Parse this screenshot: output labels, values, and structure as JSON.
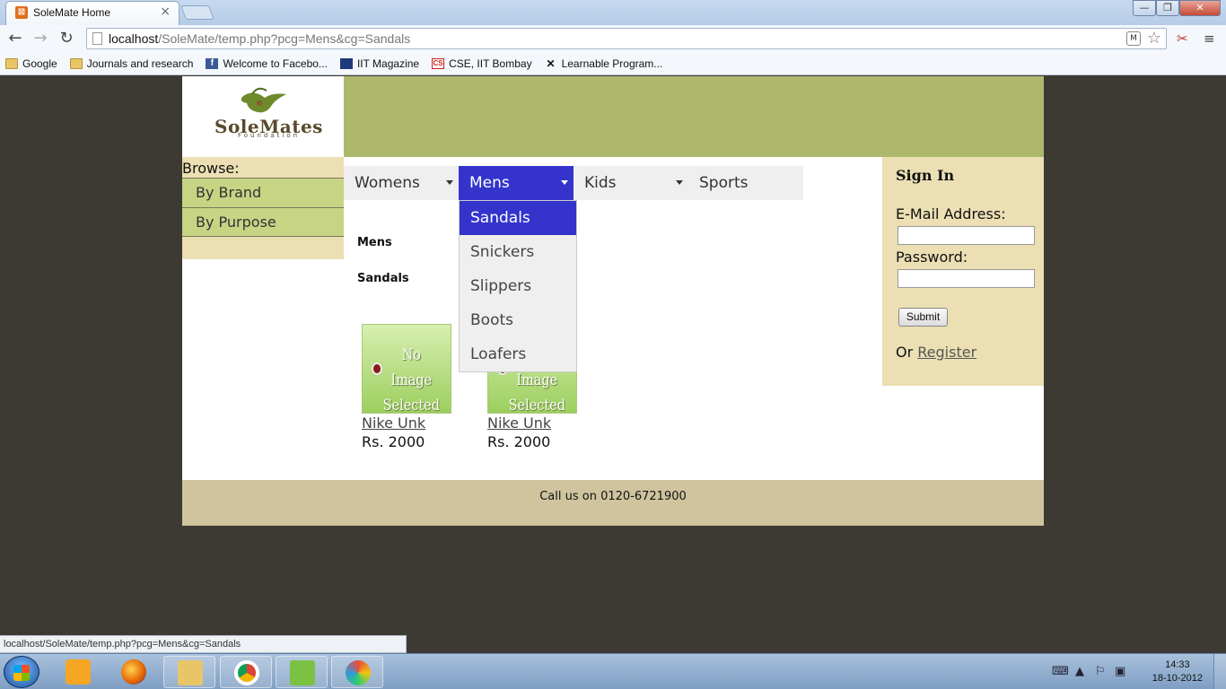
{
  "browser": {
    "tab_title": "SoleMate Home",
    "tab_close": "×",
    "window_controls": {
      "minimize": "—",
      "maximize": "❐",
      "close": "✕"
    },
    "url_host": "localhost",
    "url_path": "/SoleMate/temp.php?pcg=Mens&cg=Sandals",
    "bookmarks": [
      {
        "label": "Google",
        "icon": "folder-icon"
      },
      {
        "label": "Journals and research",
        "icon": "folder-icon"
      },
      {
        "label": "Welcome to Facebo...",
        "icon": "facebook-icon"
      },
      {
        "label": "IIT Magazine",
        "icon": "iit-icon"
      },
      {
        "label": "CSE, IIT Bombay",
        "icon": "cse-icon"
      },
      {
        "label": "Learnable Program...",
        "icon": "learnable-icon"
      }
    ],
    "status_url": "localhost/SoleMate/temp.php?pcg=Mens&cg=Sandals"
  },
  "site": {
    "logo_text": "SoleMates",
    "logo_subtext": "Foundation",
    "browse": {
      "title": "Browse:",
      "items": [
        "By Brand",
        "By Purpose"
      ]
    },
    "menu": {
      "items": [
        "Womens",
        "Mens",
        "Kids",
        "Sports"
      ],
      "active": "Mens",
      "dropdown": [
        "Sandals",
        "Snickers",
        "Slippers",
        "Boots",
        "Loafers"
      ],
      "dropdown_active": "Sandals"
    },
    "breadcrumb": {
      "category": "Mens",
      "subcategory": "Sandals"
    },
    "products": [
      {
        "thumb_text": "No Image Selected",
        "name": "Nike Unk",
        "price": "Rs. 2000"
      },
      {
        "thumb_text": "No Image Selected",
        "name": "Nike Unk",
        "price": "Rs. 2000"
      }
    ],
    "signin": {
      "title": "Sign In",
      "email_label": "E-Mail Address:",
      "password_label": "Password:",
      "submit_label": "Submit",
      "or_text": "Or",
      "register_link": "Register"
    },
    "footer": "Call us on 0120-6721900"
  },
  "taskbar": {
    "time": "14:33",
    "date": "18-10-2012"
  },
  "colors": {
    "header_band": "#aeb86d",
    "browse_bg": "#ebdfb3",
    "browse_item": "#c7d484",
    "menu_active": "#3434cc",
    "footer": "#cfc49e",
    "desktop": "#3d3a34"
  }
}
